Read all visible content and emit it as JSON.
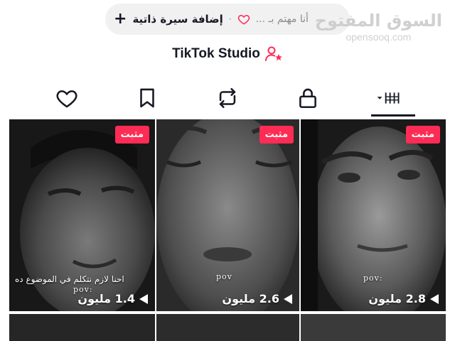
{
  "bio_bar": {
    "plus_glyph": "+",
    "add_bio_label": "إضافة سيرة ذاتية",
    "separator": "·",
    "interest_label": "أنا مهتم بـ ..."
  },
  "watermark": {
    "arabic": "السوق المفتوح",
    "latin": "opensooq.com"
  },
  "studio": {
    "label": "TikTok Studio",
    "icon": "person-star-icon"
  },
  "tabs": [
    {
      "name": "liked",
      "icon": "heart-icon",
      "active": false
    },
    {
      "name": "saved",
      "icon": "bookmark-icon",
      "active": false
    },
    {
      "name": "reposts",
      "icon": "repost-icon",
      "active": false
    },
    {
      "name": "private",
      "icon": "lock-icon",
      "active": false
    },
    {
      "name": "videos",
      "icon": "grid-icon",
      "active": true
    }
  ],
  "colors": {
    "pinned_badge": "#fe2c55",
    "text_primary": "#161823",
    "text_secondary": "#8a8b91"
  },
  "videos": [
    {
      "pinned_label": "مثبت",
      "views": "2.8 مليون",
      "overlay_text": "pov:",
      "caption": ""
    },
    {
      "pinned_label": "مثبت",
      "views": "2.6 مليون",
      "overlay_text": "pov",
      "caption": ""
    },
    {
      "pinned_label": "مثبت",
      "views": "1.4 مليون",
      "overlay_text": "pov:",
      "caption": "احنا لازم نتكلم في الموضوع ده"
    }
  ]
}
